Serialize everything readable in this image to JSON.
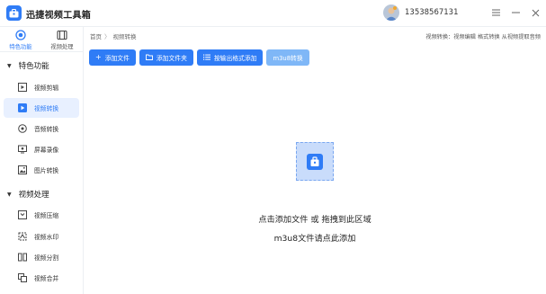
{
  "app": {
    "title": "迅捷视频工具箱",
    "account": "13538567131",
    "accent_color": "#2f7cf6"
  },
  "topnav": [
    {
      "label": "特色功能",
      "icon": "special-features-icon",
      "active": true
    },
    {
      "label": "视频处理",
      "icon": "video-processing-icon",
      "active": false
    }
  ],
  "sidebar": {
    "groups": [
      {
        "title": "特色功能",
        "items": [
          {
            "label": "视频剪辑",
            "icon": "video-edit-icon"
          },
          {
            "label": "视频转换",
            "icon": "video-convert-icon",
            "active": true
          },
          {
            "label": "音频转换",
            "icon": "audio-convert-icon"
          },
          {
            "label": "屏幕录像",
            "icon": "screen-record-icon"
          },
          {
            "label": "图片转换",
            "icon": "image-convert-icon"
          }
        ]
      },
      {
        "title": "视频处理",
        "items": [
          {
            "label": "视频压缩",
            "icon": "video-compress-icon"
          },
          {
            "label": "视频水印",
            "icon": "video-watermark-icon"
          },
          {
            "label": "视频分割",
            "icon": "video-split-icon"
          },
          {
            "label": "视频合并",
            "icon": "video-merge-icon"
          }
        ]
      }
    ]
  },
  "breadcrumb": {
    "home": "首页",
    "separator": "〉",
    "current": "视频转换"
  },
  "help_links": "视频转换：视频编辑 格式转换 从视频提取音频",
  "toolbar": {
    "add_file": "添加文件",
    "add_folder": "添加文件夹",
    "add_by_format": "按输出格式添加",
    "m3u8": "m3u8转换"
  },
  "dropzone": {
    "line1": "点击添加文件 或 拖拽到此区域",
    "line2": "m3u8文件请点此添加"
  }
}
